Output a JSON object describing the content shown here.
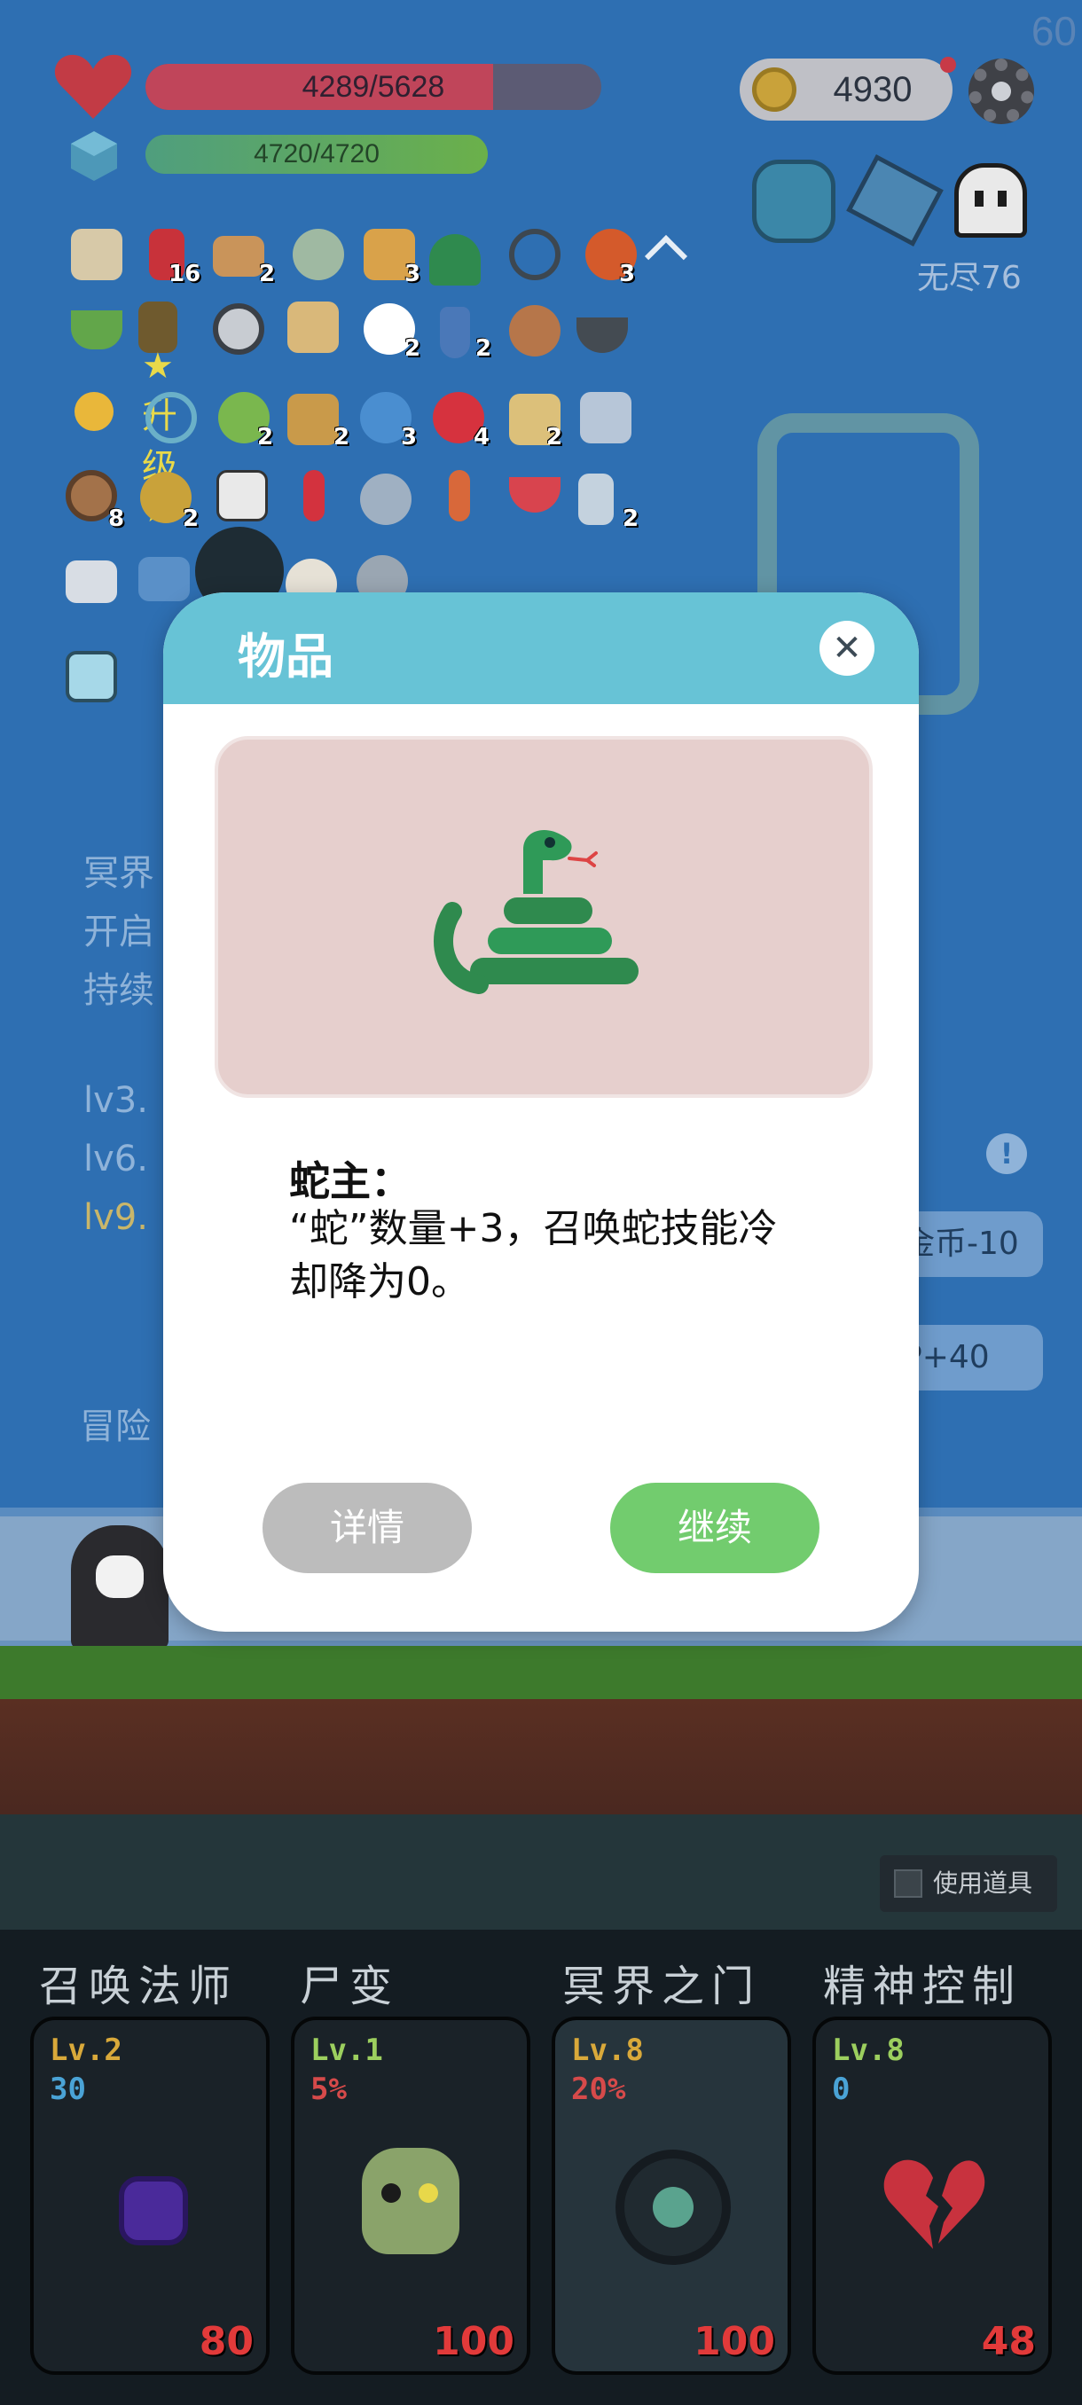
{
  "hud": {
    "fps": "60",
    "hp_text": "4289/5628",
    "hp_fraction": 0.762,
    "mp_text": "4720/4720",
    "mp_fraction": 1.0,
    "coins": "4930",
    "endless_label": "无尽76",
    "notification_dot": true
  },
  "inventory": {
    "counts": [
      "16",
      "2",
      "3",
      "3",
      "2",
      "2",
      "2",
      "2",
      "3",
      "4",
      "2",
      "8",
      "2",
      "2",
      "2"
    ],
    "upgrade_label": "★升级★"
  },
  "background_text": {
    "line1": "冥界",
    "line2": "开启",
    "line3": "持续",
    "line4": "lv3.",
    "line5": "lv6.",
    "line6": "lv9.",
    "adventure": "冒险",
    "chip_coin": "金币-10",
    "chip_p": "P+40",
    "info_icon": "!"
  },
  "use_item": {
    "label": "使用道具"
  },
  "skills": [
    {
      "title": "召唤法师",
      "level": "Lv.2",
      "value": "30",
      "value_color": "#4aa3d6",
      "cost": "80",
      "icon": "purple-orb-icon"
    },
    {
      "title": "尸变",
      "level": "Lv.1",
      "value": "5%",
      "value_color": "#d64a4a",
      "cost": "100",
      "icon": "zombie-icon"
    },
    {
      "title": "冥界之门",
      "level": "Lv.8",
      "value": "20%",
      "value_color": "#d64a4a",
      "cost": "100",
      "icon": "portal-icon"
    },
    {
      "title": "精神控制",
      "level": "Lv.8",
      "value": "0",
      "value_color": "#4aa3d6",
      "cost": "48",
      "icon": "broken-heart-icon"
    }
  ],
  "modal": {
    "title": "物品",
    "close_glyph": "✕",
    "item_name": "蛇主：",
    "item_description": "“蛇”数量+3，召唤蛇技能冷却降为0。",
    "details_button": "详情",
    "continue_button": "继续",
    "item_icon": "snake-icon"
  },
  "colors": {
    "modal_header": "#67c3d6",
    "continue_green": "#72cc6e",
    "details_gray": "#bcbcbc",
    "level_gold": "#d9a93a",
    "level_green": "#9ccf5e"
  }
}
